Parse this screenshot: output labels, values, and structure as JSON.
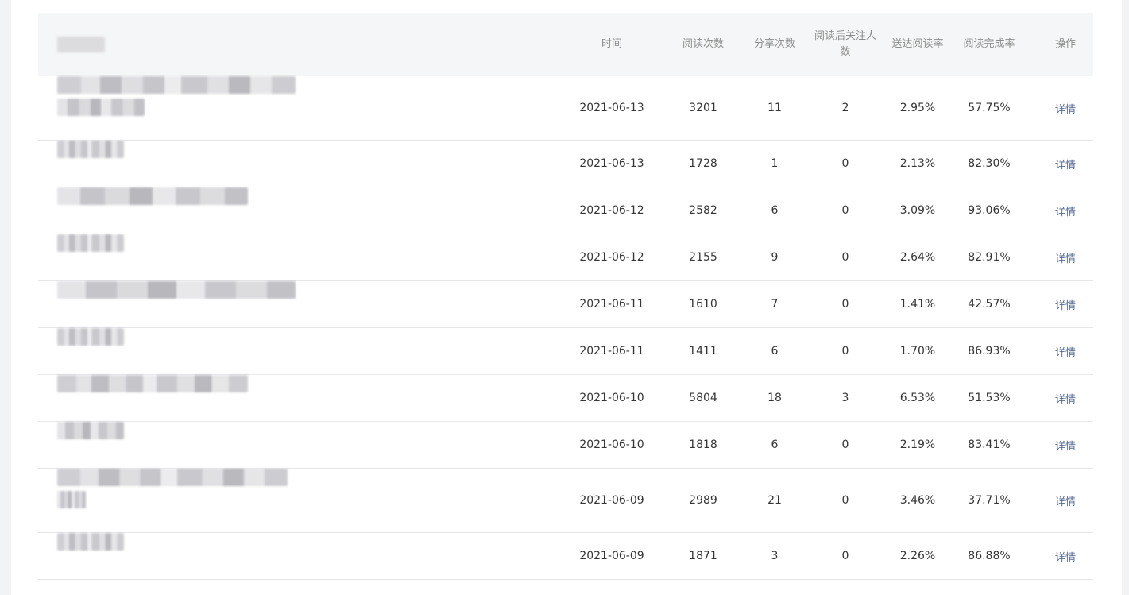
{
  "table": {
    "headers": {
      "time": "时间",
      "reads": "阅读次数",
      "shares": "分享次数",
      "follows": "阅读后关注人数",
      "delivery_rate": "送达阅读率",
      "completion_rate": "阅读完成率",
      "action": "操作"
    },
    "rows": [
      {
        "date": "2021-06-13",
        "reads": "3201",
        "shares": "11",
        "follows": "2",
        "delivery_rate": "2.95%",
        "completion_rate": "57.75%",
        "action": "详情"
      },
      {
        "date": "2021-06-13",
        "reads": "1728",
        "shares": "1",
        "follows": "0",
        "delivery_rate": "2.13%",
        "completion_rate": "82.30%",
        "action": "详情"
      },
      {
        "date": "2021-06-12",
        "reads": "2582",
        "shares": "6",
        "follows": "0",
        "delivery_rate": "3.09%",
        "completion_rate": "93.06%",
        "action": "详情"
      },
      {
        "date": "2021-06-12",
        "reads": "2155",
        "shares": "9",
        "follows": "0",
        "delivery_rate": "2.64%",
        "completion_rate": "82.91%",
        "action": "详情"
      },
      {
        "date": "2021-06-11",
        "reads": "1610",
        "shares": "7",
        "follows": "0",
        "delivery_rate": "1.41%",
        "completion_rate": "42.57%",
        "action": "详情"
      },
      {
        "date": "2021-06-11",
        "reads": "1411",
        "shares": "6",
        "follows": "0",
        "delivery_rate": "1.70%",
        "completion_rate": "86.93%",
        "action": "详情"
      },
      {
        "date": "2021-06-10",
        "reads": "5804",
        "shares": "18",
        "follows": "3",
        "delivery_rate": "6.53%",
        "completion_rate": "51.53%",
        "action": "详情"
      },
      {
        "date": "2021-06-10",
        "reads": "1818",
        "shares": "6",
        "follows": "0",
        "delivery_rate": "2.19%",
        "completion_rate": "83.41%",
        "action": "详情"
      },
      {
        "date": "2021-06-09",
        "reads": "2989",
        "shares": "21",
        "follows": "0",
        "delivery_rate": "3.46%",
        "completion_rate": "37.71%",
        "action": "详情"
      },
      {
        "date": "2021-06-09",
        "reads": "1871",
        "shares": "3",
        "follows": "0",
        "delivery_rate": "2.26%",
        "completion_rate": "86.88%",
        "action": "详情"
      }
    ]
  }
}
